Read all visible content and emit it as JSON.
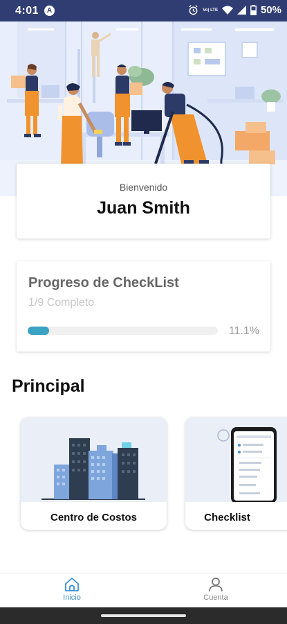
{
  "status_bar": {
    "time": "4:01",
    "app_icon": "A",
    "battery": "50%",
    "icons": [
      "alarm-icon",
      "volte-icon",
      "wifi-icon",
      "signal-icon",
      "battery-icon"
    ],
    "volte_text": "Vo) LTE"
  },
  "welcome": {
    "label": "Bienvenido",
    "name": "Juan Smith"
  },
  "progress": {
    "title": "Progreso de CheckList",
    "subtitle": "1/9 Completo",
    "value": 0.111,
    "percent_label": "11.1%"
  },
  "section": {
    "title": "Principal"
  },
  "cards": [
    {
      "label": "Centro de Costos",
      "icon": "buildings-illustration"
    },
    {
      "label": "Checklist",
      "icon": "phone-checklist-illustration"
    }
  ],
  "bottom_nav": {
    "home_label": "Inicio",
    "account_label": "Cuenta"
  },
  "colors": {
    "status_bar": "#2f3d73",
    "accent": "#3b8fd0",
    "progress_fill": "#3aa2c2",
    "hero_bg": "#e8eefb",
    "worker_orange": "#f0922e",
    "worker_navy": "#2b3a67"
  }
}
